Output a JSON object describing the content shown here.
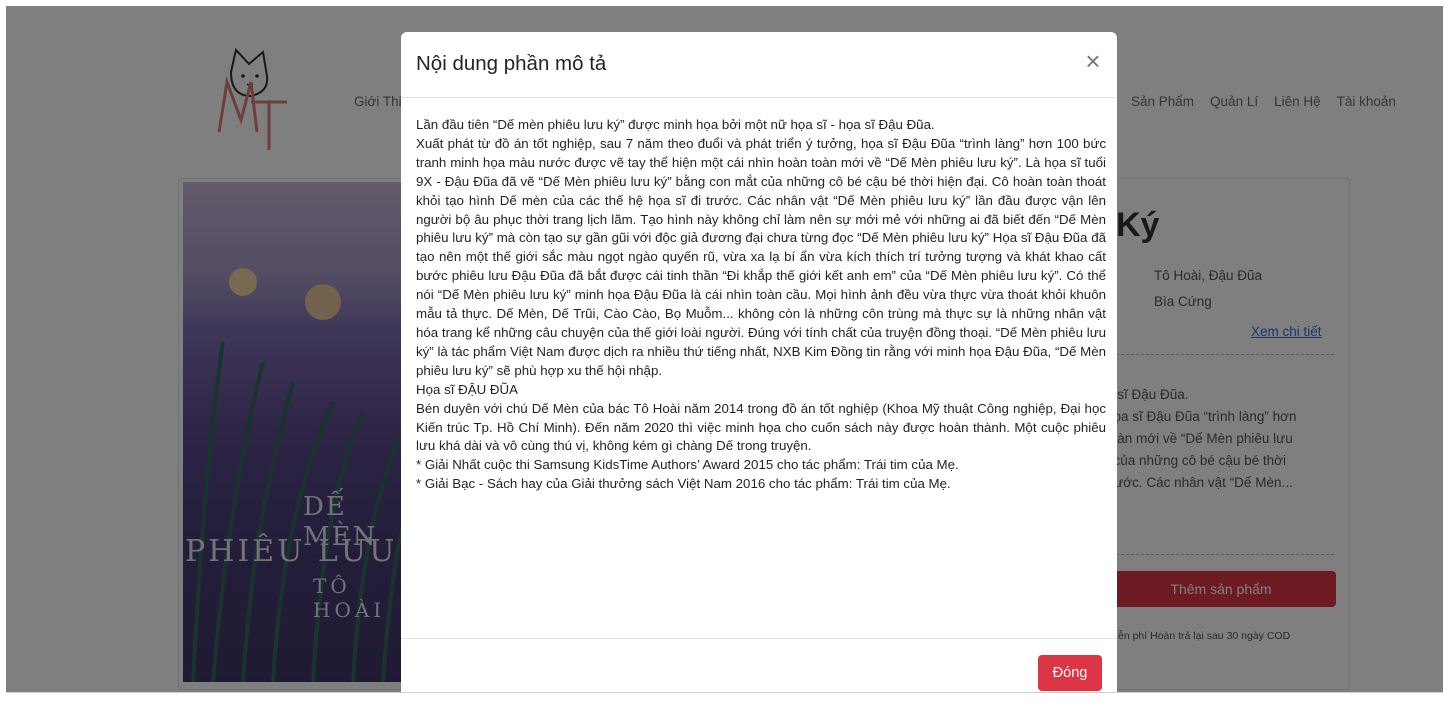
{
  "nav": {
    "items": [
      "Giới Thiệu",
      "Sản Phẩm",
      "Quản Lí",
      "Liên Hệ",
      "Tài khoản"
    ]
  },
  "product": {
    "cover_lines": [
      "DẾ MÈN",
      "PHIÊU LƯU KÝ",
      "TÔ HOÀI"
    ],
    "title_fragment": "Ký",
    "author": "Tô Hoài, Đậu Đũa",
    "cover_type": "Bìa Cứng",
    "detail_link": "Xem chi tiết",
    "desc_lines": [
      "a sĩ Đậu Đũa.",
      "họa sĩ Đậu Đũa “trình làng” hơn",
      "toàn mới về “Dế Mèn phiêu lưu",
      "t của những cô bé cậu bé thời",
      "trước. Các nhân vật “Dế Mèn..."
    ],
    "add_button": "Thêm sản phẩm",
    "shipping": "ễn phí   Hoàn trả lại sau 30 ngày   COD"
  },
  "modal": {
    "title": "Nội dung phần mô tả",
    "paragraphs": [
      "Lần đầu tiên “Dế mèn phiêu lưu ký” được minh họa bởi một nữ họa sĩ - họa sĩ Đậu Đũa.",
      "Xuất phát từ đồ án tốt nghiệp, sau 7 năm theo đuổi và phát triển ý tưởng, họa sĩ Đậu Đũa “trình làng” hơn 100 bức tranh minh họa màu nước được vẽ tay thể hiện một cái nhìn hoàn toàn mới về “Dế Mèn phiêu lưu ký”. Là họa sĩ tuổi 9X - Đậu Đũa đã vẽ “Dế Mèn phiêu lưu ký” bằng con mắt của những cô bé cậu bé thời hiện đại. Cô hoàn toàn thoát khỏi tạo hình Dế mèn của các thế hệ họa sĩ đi trước. Các nhân vật “Dế Mèn phiêu lưu ký” lần đầu được vận lên người bộ âu phục thời trang lịch lãm. Tạo hình này không chỉ làm nên sự mới mẻ với những ai đã biết đến “Dế Mèn phiêu lưu ký” mà còn tạo sự gần gũi với độc giả đương đại chưa từng đọc “Dế Mèn phiêu lưu ký” Họa sĩ Đậu Đũa đã tạo nên một thế giới sắc màu ngọt ngào quyến rũ, vừa xa lạ bí ẩn vừa kích thích trí tưởng tượng và khát khao cất bước phiêu lưu Đậu Đũa đã bắt được cái tinh thần “Đi khắp thế giới kết anh em” của “Dế Mèn phiêu lưu ký”. Có thể nói “Dế Mèn phiêu lưu ký” minh họa Đậu Đũa là cái nhìn toàn cầu. Mọi hình ảnh đều vừa thực vừa thoát khỏi khuôn mẫu tả thực. Dế Mèn, Dế Trũi, Cào Cào, Bọ Muỗm... không còn là những côn trùng mà thực sự là những nhân vật hóa trang kể những câu chuyện của thế giới loài người. Đúng với tính chất của truyện đồng thoại. “Dế Mèn phiêu lưu ký” là tác phẩm Việt Nam được dịch ra nhiều thứ tiếng nhất, NXB Kim Đồng tin rằng với minh họa Đậu Đũa, “Dế Mèn phiêu lưu ký” sẽ phù hợp xu thế hội nhập.",
      "Họa sĩ ĐẬU ĐŨA",
      "Bén duyên với chú Dế Mèn của bác Tô Hoài năm 2014 trong đồ án tốt nghiệp (Khoa Mỹ thuật Công nghiệp, Đại học Kiến trúc Tp. Hồ Chí Minh). Đến năm 2020 thì việc minh họa cho cuốn sách này được hoàn thành. Một cuộc phiêu lưu khá dài và vô cùng thú vị, không kém gì chàng Dế trong truyện.",
      "* Giải Nhất cuộc thi Samsung KidsTime Authors’ Award 2015 cho tác phẩm: Trái tim của Mẹ.",
      "* Giải Bạc - Sách hay của Giải thưởng sách Việt Nam 2016 cho tác phẩm: Trái tim của Mẹ."
    ],
    "close_button": "Đóng"
  },
  "colors": {
    "accent": "#dc3545",
    "link": "#3b6bd8"
  }
}
